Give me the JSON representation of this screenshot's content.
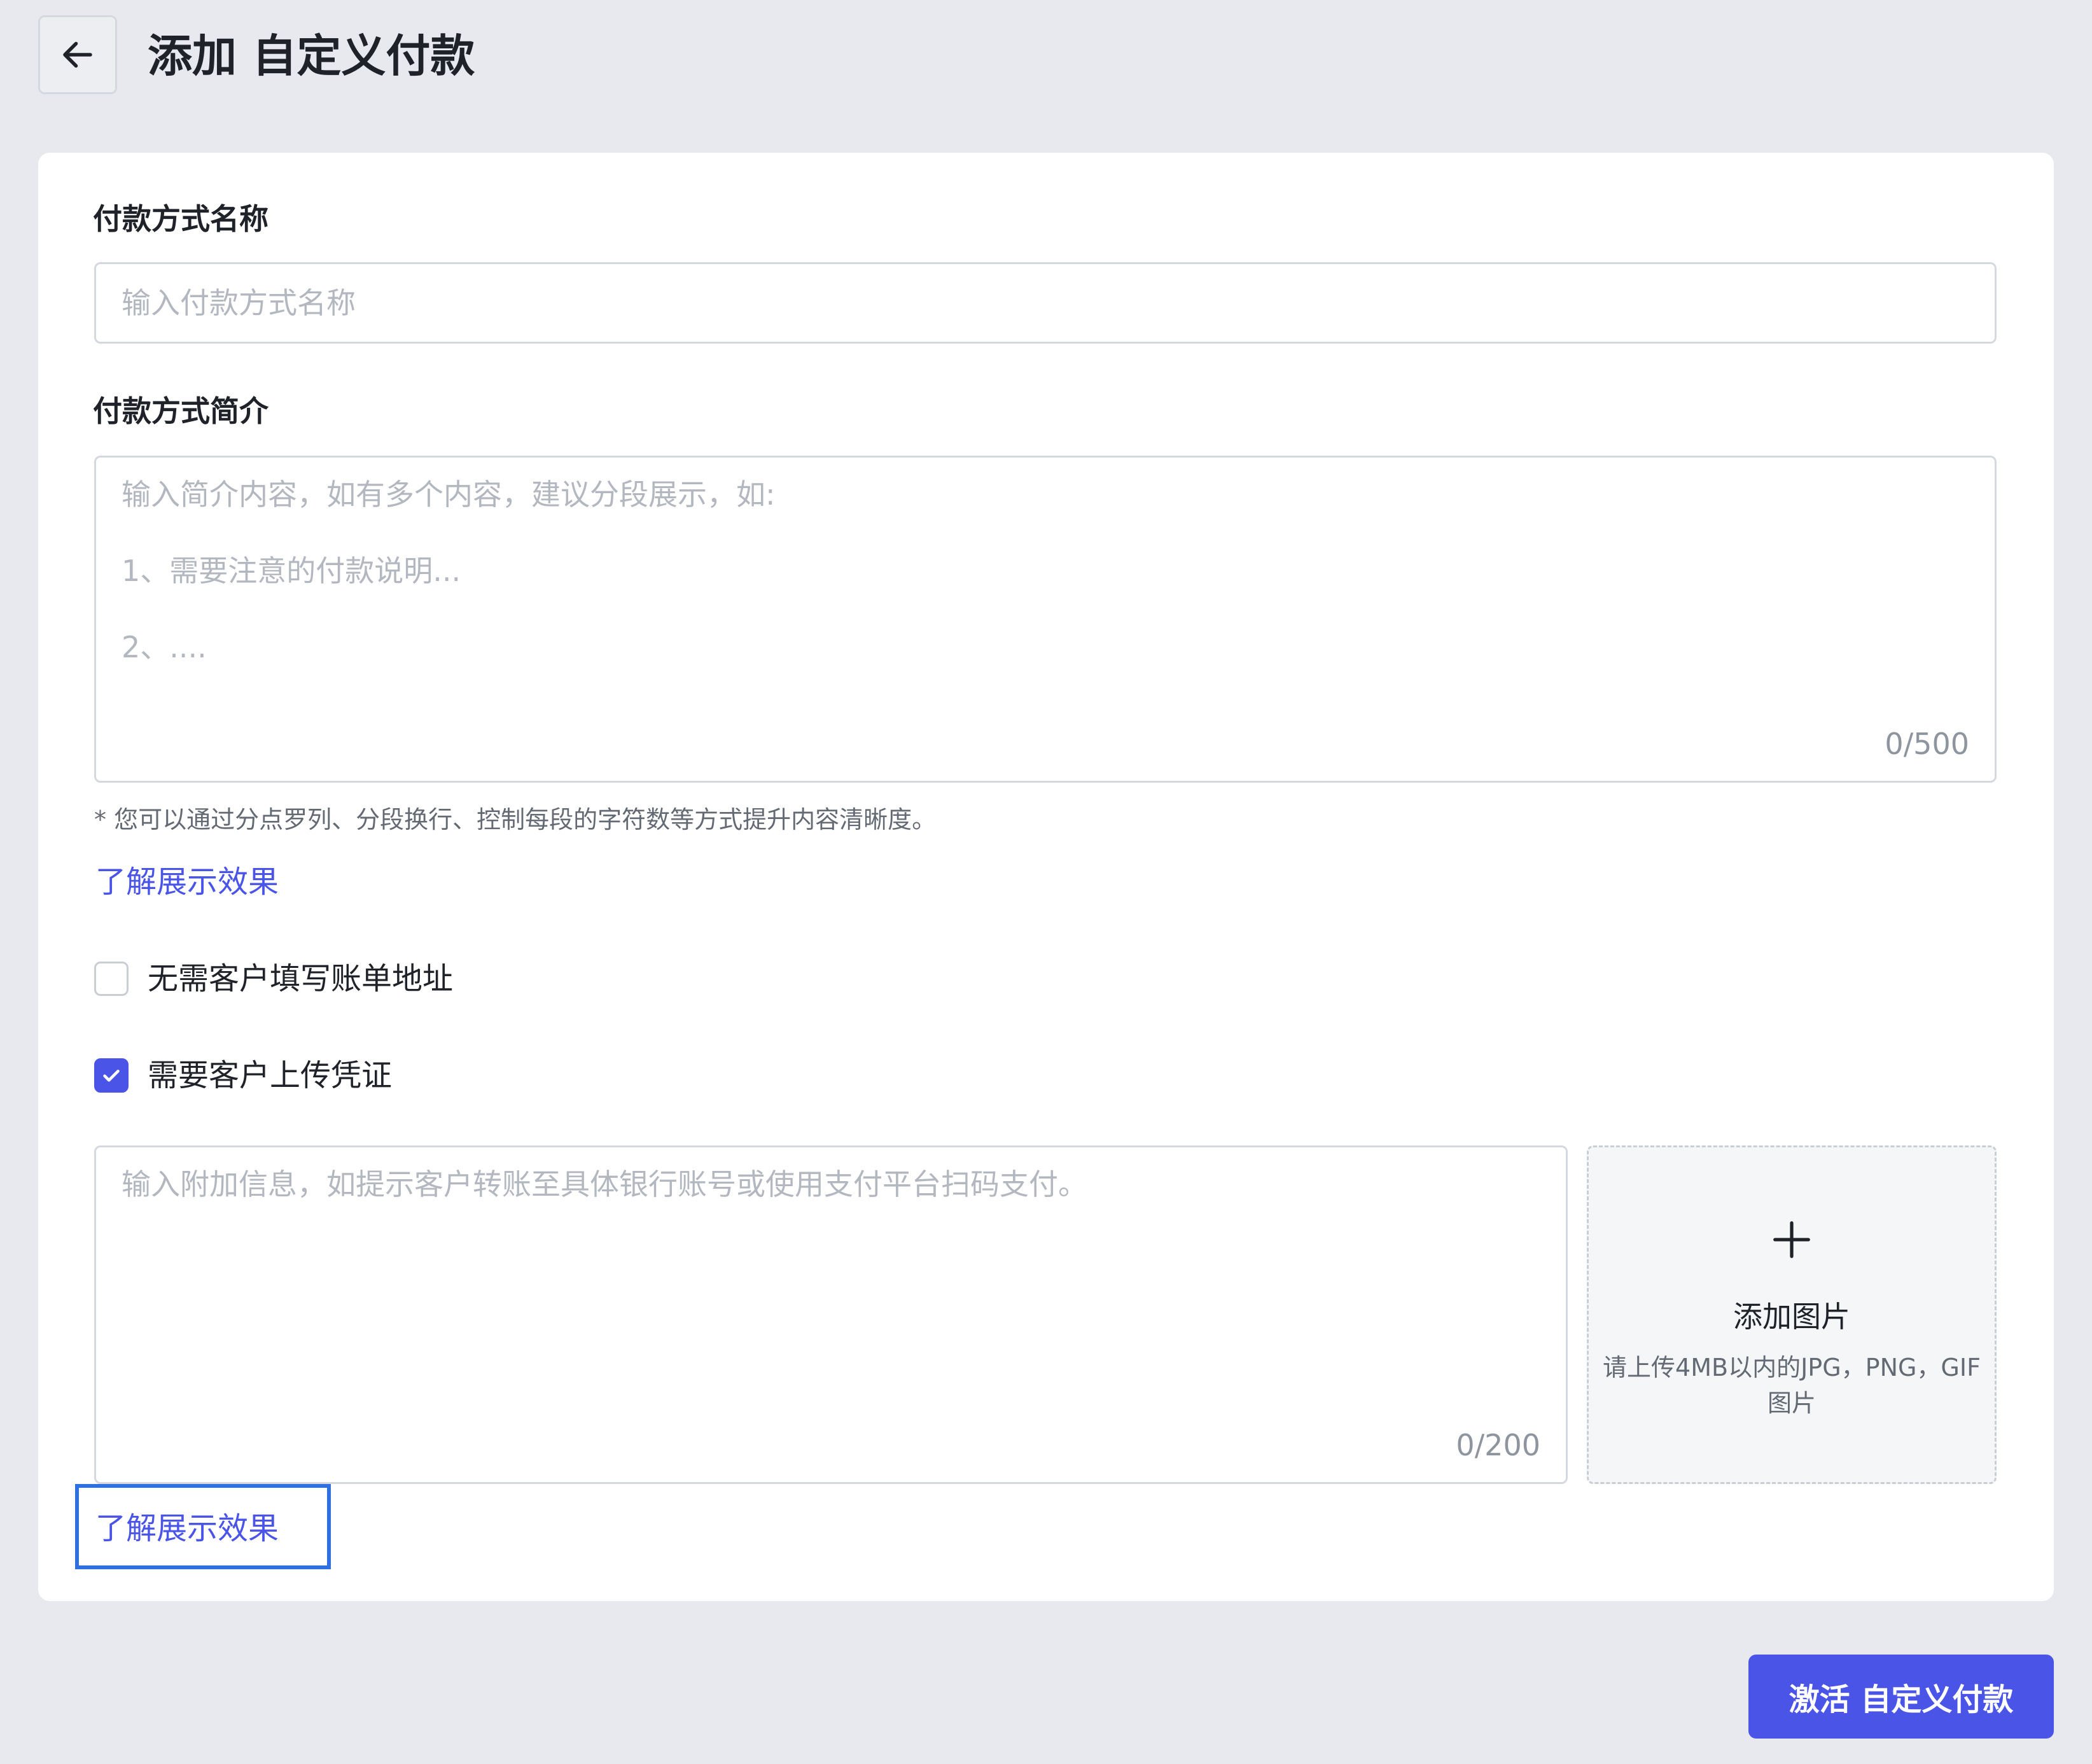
{
  "header": {
    "title": "添加 自定义付款",
    "back_icon": "arrow-left-icon"
  },
  "form": {
    "name_field": {
      "label": "付款方式名称",
      "placeholder": "输入付款方式名称",
      "value": ""
    },
    "intro_field": {
      "label": "付款方式简介",
      "placeholder_lines": [
        "输入简介内容，如有多个内容，建议分段展示，如:",
        "",
        "1、需要注意的付款说明...",
        "",
        "2、...."
      ],
      "counter": "0/500"
    },
    "hint": "* 您可以通过分点罗列、分段换行、控制每段的字符数等方式提升内容清晰度。",
    "learn_more_link": "了解展示效果",
    "options": [
      {
        "label": "无需客户填写账单地址",
        "checked": false
      },
      {
        "label": "需要客户上传凭证",
        "checked": true
      }
    ],
    "extra_info": {
      "placeholder": "输入附加信息，如提示客户转账至具体银行账号或使用支付平台扫码支付。",
      "counter": "0/200"
    },
    "upload": {
      "icon": "plus-icon",
      "title": "添加图片",
      "description": "请上传4MB以内的JPG，PNG，GIF图片"
    },
    "learn_more_link_2": "了解展示效果"
  },
  "footer": {
    "activate_button": "激活 自定义付款"
  },
  "colors": {
    "accent": "#4a55e8",
    "background": "#e7e9ee",
    "card": "#ffffff",
    "highlight": "#2f6fe0"
  }
}
